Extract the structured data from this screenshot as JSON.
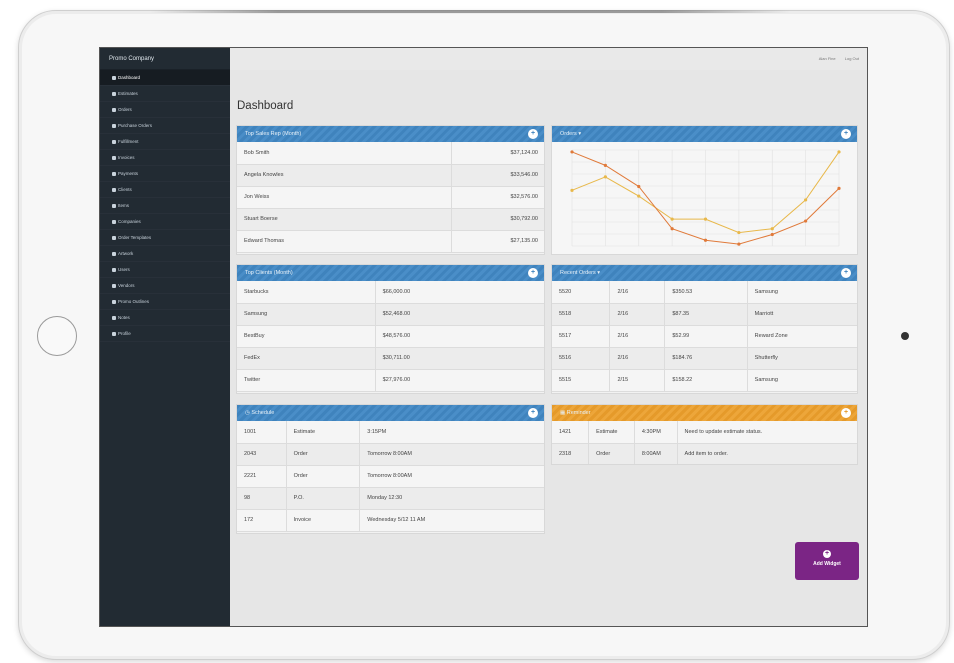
{
  "sidebar": {
    "brand": "Promo Company",
    "items": [
      {
        "label": "Dashboard",
        "icon": "home-icon",
        "active": true
      },
      {
        "label": "Estimates"
      },
      {
        "label": "Orders"
      },
      {
        "label": "Purchase Orders"
      },
      {
        "label": "Fulfillment"
      },
      {
        "label": "Invoices"
      },
      {
        "label": "Payments"
      },
      {
        "label": "Clients"
      },
      {
        "label": "Items"
      },
      {
        "label": "Companies"
      },
      {
        "label": "Order Templates"
      },
      {
        "label": "Artwork"
      },
      {
        "label": "Users"
      },
      {
        "label": "Vendors"
      },
      {
        "label": "Promo Outlines"
      },
      {
        "label": "Notes"
      },
      {
        "label": "Profile"
      }
    ]
  },
  "topbar": {
    "link1": "Alan Fine",
    "link2": "Log Out"
  },
  "page": {
    "title": "Dashboard"
  },
  "top_sales": {
    "title": "Top Sales Rep (Month)",
    "rows": [
      [
        "Bob Smith",
        "$37,124.00"
      ],
      [
        "Angela Knowles",
        "$33,546.00"
      ],
      [
        "Jon Weiss",
        "$32,576.00"
      ],
      [
        "Stuart Boerse",
        "$30,792.00"
      ],
      [
        "Edward Thomas",
        "$27,135.00"
      ]
    ]
  },
  "orders_chart": {
    "title": "Orders ▾"
  },
  "chart_data": {
    "type": "line",
    "series": [
      {
        "color": "#e8b84a",
        "values": [
          58,
          72,
          52,
          28,
          28,
          14,
          18,
          48,
          98
        ]
      },
      {
        "color": "#e07a3a",
        "values": [
          98,
          84,
          62,
          18,
          6,
          2,
          12,
          26,
          60
        ]
      }
    ],
    "ylim": [
      0,
      100
    ],
    "grid": true
  },
  "top_clients": {
    "title": "Top Clients (Month)",
    "rows": [
      [
        "Starbucks",
        "$66,000.00"
      ],
      [
        "Samsung",
        "$52,468.00"
      ],
      [
        "BestBuy",
        "$48,576.00"
      ],
      [
        "FedEx",
        "$30,711.00"
      ],
      [
        "Twitter",
        "$27,976.00"
      ]
    ]
  },
  "recent_orders": {
    "title": "Recent Orders ▾",
    "rows": [
      [
        "5520",
        "2/16",
        "$350.53",
        "Samsung"
      ],
      [
        "5518",
        "2/16",
        "$87.35",
        "Marriott"
      ],
      [
        "5517",
        "2/16",
        "$52.99",
        "Reward Zone"
      ],
      [
        "5516",
        "2/16",
        "$184.76",
        "Shutterfly"
      ],
      [
        "5515",
        "2/15",
        "$158.22",
        "Samsung"
      ]
    ]
  },
  "schedule": {
    "title": "Schedule",
    "rows": [
      [
        "1001",
        "Estimate",
        "3:15PM"
      ],
      [
        "2043",
        "Order",
        "Tomorrow 8:00AM"
      ],
      [
        "2221",
        "Order",
        "Tomorrow 8:00AM"
      ],
      [
        "98",
        "P.O.",
        "Monday 12:30"
      ],
      [
        "172",
        "Invoice",
        "Wednesday 5/12 11 AM"
      ]
    ]
  },
  "reminder": {
    "title": "Reminder",
    "rows": [
      [
        "1421",
        "Estimate",
        "4:30PM",
        "Need to update estimate status."
      ],
      [
        "2318",
        "Order",
        "8:00AM",
        "Add item to order."
      ]
    ]
  },
  "add_widget": {
    "label": "Add Widget"
  }
}
